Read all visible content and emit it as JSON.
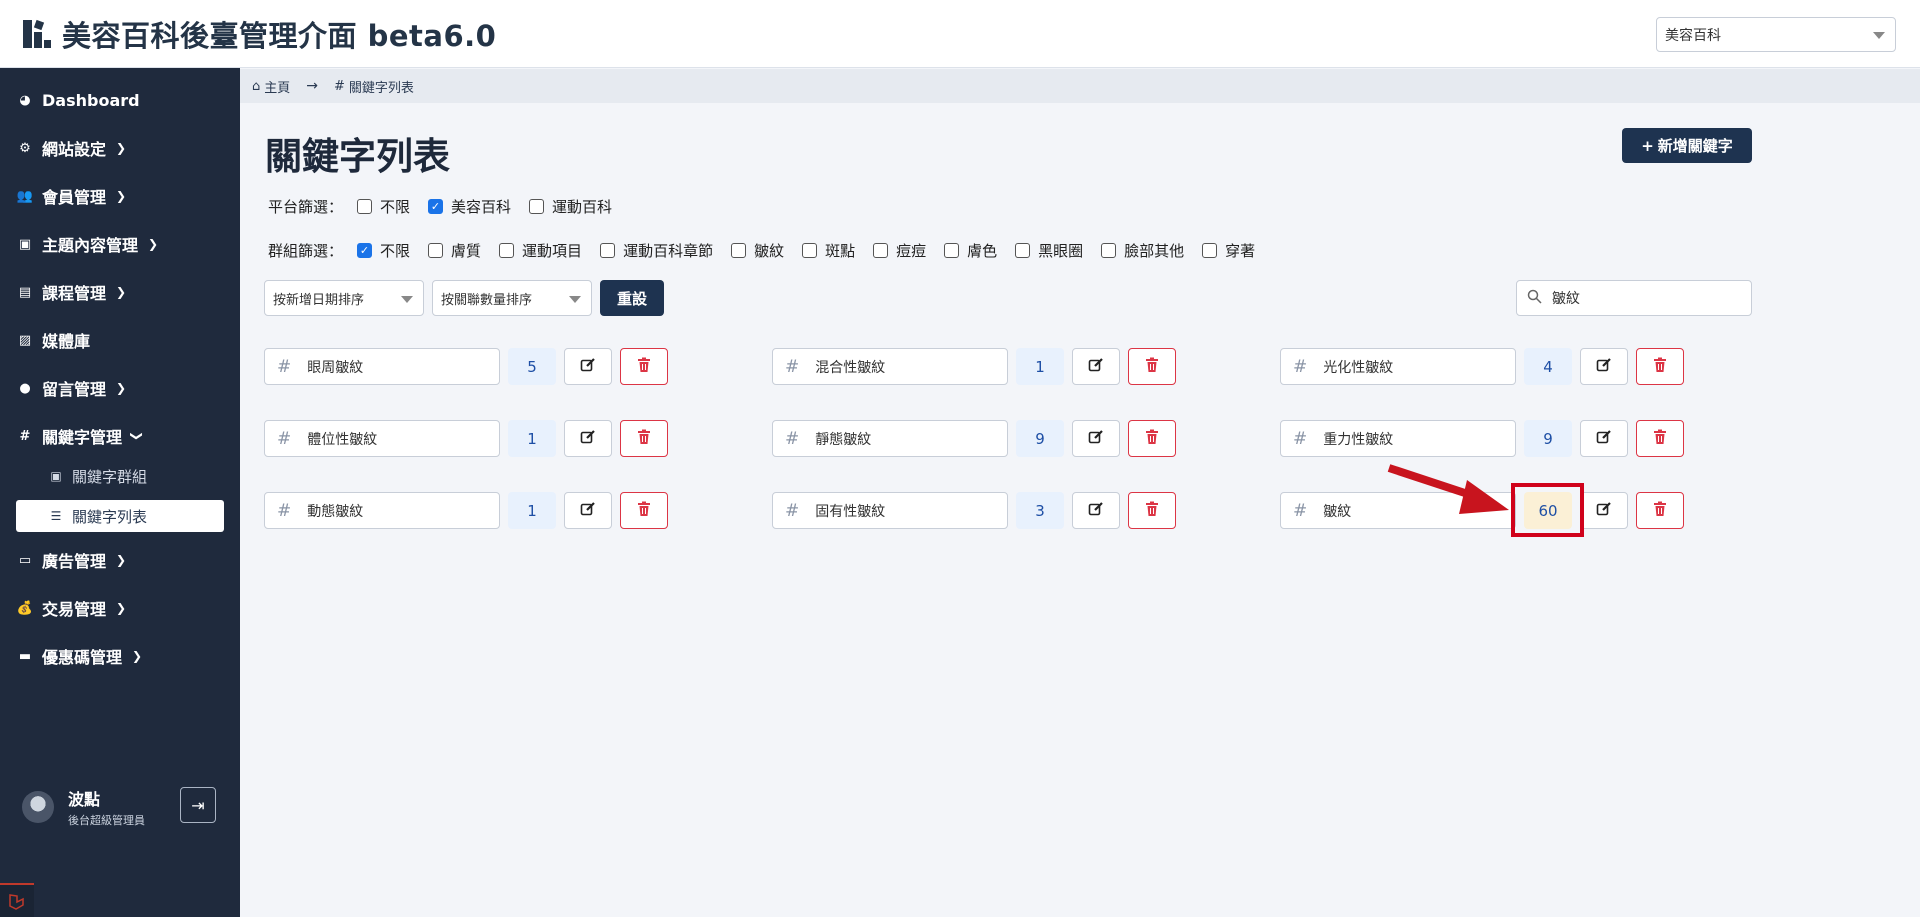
{
  "header": {
    "title": "美容百科後臺管理介面 beta6.0",
    "platform_select": "美容百科"
  },
  "sidebar": {
    "items": [
      {
        "label": "Dashboard",
        "icon": "dashboard-icon"
      },
      {
        "label": "網站設定",
        "icon": "gear-icon"
      },
      {
        "label": "會員管理",
        "icon": "users-icon"
      },
      {
        "label": "主題內容管理",
        "icon": "image-icon"
      },
      {
        "label": "課程管理",
        "icon": "book-icon"
      },
      {
        "label": "媒體庫",
        "icon": "images-icon"
      },
      {
        "label": "留言管理",
        "icon": "comment-icon"
      },
      {
        "label": "關鍵字管理",
        "icon": "hash-icon"
      },
      {
        "label": "廣告管理",
        "icon": "ad-icon"
      },
      {
        "label": "交易管理",
        "icon": "money-bag-icon"
      },
      {
        "label": "優惠碼管理",
        "icon": "ticket-icon"
      }
    ],
    "sub_items": [
      {
        "label": "關鍵字群組",
        "icon": "group-icon"
      },
      {
        "label": "關鍵字列表",
        "icon": "list-icon"
      }
    ],
    "user": {
      "name": "波點",
      "role": "後台超級管理員"
    }
  },
  "breadcrumb": {
    "home": "主頁",
    "current": "關鍵字列表"
  },
  "page": {
    "title": "關鍵字列表",
    "add_button": "新增關鍵字",
    "platform_filter_label": "平台篩選：",
    "platform_filters": [
      {
        "label": "不限",
        "checked": false
      },
      {
        "label": "美容百科",
        "checked": true
      },
      {
        "label": "運動百科",
        "checked": false
      }
    ],
    "group_filter_label": "群組篩選：",
    "group_filters": [
      {
        "label": "不限",
        "checked": true
      },
      {
        "label": "膚質",
        "checked": false
      },
      {
        "label": "運動項目",
        "checked": false
      },
      {
        "label": "運動百科章節",
        "checked": false
      },
      {
        "label": "皺紋",
        "checked": false
      },
      {
        "label": "斑點",
        "checked": false
      },
      {
        "label": "痘痘",
        "checked": false
      },
      {
        "label": "膚色",
        "checked": false
      },
      {
        "label": "黑眼圈",
        "checked": false
      },
      {
        "label": "臉部其他",
        "checked": false
      },
      {
        "label": "穿著",
        "checked": false
      }
    ],
    "sort_date": "按新增日期排序",
    "sort_count": "按關聯數量排序",
    "reset_button": "重設",
    "search_value": "皺紋"
  },
  "keywords": [
    {
      "name": "眼周皺紋",
      "count": "5"
    },
    {
      "name": "混合性皺紋",
      "count": "1"
    },
    {
      "name": "光化性皺紋",
      "count": "4"
    },
    {
      "name": "體位性皺紋",
      "count": "1"
    },
    {
      "name": "靜態皺紋",
      "count": "9"
    },
    {
      "name": "重力性皺紋",
      "count": "9"
    },
    {
      "name": "動態皺紋",
      "count": "1"
    },
    {
      "name": "固有性皺紋",
      "count": "3"
    },
    {
      "name": "皺紋",
      "count": "60"
    }
  ]
}
